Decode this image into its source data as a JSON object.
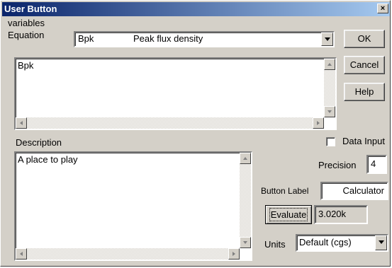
{
  "window": {
    "title": "User Button",
    "close_glyph": "×"
  },
  "variables": {
    "label": "variables",
    "selected_symbol": "Bpk",
    "selected_description": "Peak flux density"
  },
  "equation": {
    "label": "Equation",
    "value": "Bpk"
  },
  "buttons": {
    "ok": "OK",
    "cancel": "Cancel",
    "help": "Help",
    "evaluate": "Evaluate"
  },
  "description": {
    "label": "Description",
    "value": "A place to play"
  },
  "data_input": {
    "label": "Data Input",
    "checked": false
  },
  "precision": {
    "label": "Precision",
    "value": "4"
  },
  "button_label": {
    "label": "Button Label",
    "value": "Calculator"
  },
  "evaluate_result": "3.020k",
  "units": {
    "label": "Units",
    "selected": "Default (cgs)"
  }
}
